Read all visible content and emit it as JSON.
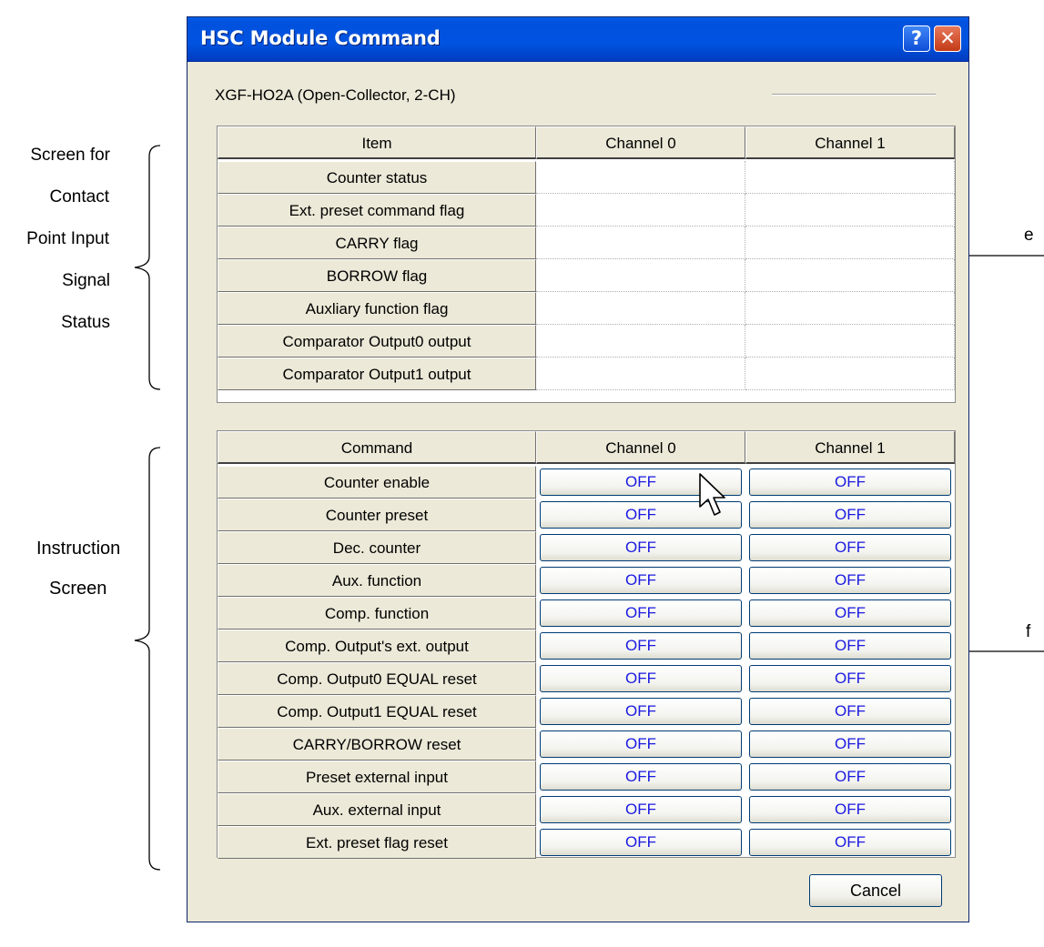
{
  "annotations": {
    "status_lines": [
      "Screen for",
      "Contact",
      "Point Input",
      "Signal",
      "Status"
    ],
    "instruction_lines": [
      "Instruction",
      "Screen"
    ],
    "marker_e": "e",
    "marker_f": "f"
  },
  "window": {
    "title": "HSC Module Command",
    "help_label": "?",
    "close_label": "✕"
  },
  "module": {
    "name": "XGF-HO2A (Open-Collector, 2-CH)"
  },
  "status_table": {
    "headers": [
      "Item",
      "Channel 0",
      "Channel 1"
    ],
    "rows": [
      "Counter status",
      "Ext. preset command flag",
      "CARRY flag",
      "BORROW flag",
      "Auxliary function flag",
      "Comparator Output0 output",
      "Comparator Output1 output"
    ]
  },
  "command_table": {
    "headers": [
      "Command",
      "Channel 0",
      "Channel 1"
    ],
    "rows": [
      {
        "label": "Counter enable",
        "ch0": "OFF",
        "ch1": "OFF"
      },
      {
        "label": "Counter preset",
        "ch0": "OFF",
        "ch1": "OFF"
      },
      {
        "label": "Dec. counter",
        "ch0": "OFF",
        "ch1": "OFF"
      },
      {
        "label": "Aux. function",
        "ch0": "OFF",
        "ch1": "OFF"
      },
      {
        "label": "Comp. function",
        "ch0": "OFF",
        "ch1": "OFF"
      },
      {
        "label": "Comp. Output's ext. output",
        "ch0": "OFF",
        "ch1": "OFF"
      },
      {
        "label": "Comp. Output0 EQUAL reset",
        "ch0": "OFF",
        "ch1": "OFF"
      },
      {
        "label": "Comp. Output1 EQUAL reset",
        "ch0": "OFF",
        "ch1": "OFF"
      },
      {
        "label": "CARRY/BORROW reset",
        "ch0": "OFF",
        "ch1": "OFF"
      },
      {
        "label": "Preset external input",
        "ch0": "OFF",
        "ch1": "OFF"
      },
      {
        "label": "Aux. external input",
        "ch0": "OFF",
        "ch1": "OFF"
      },
      {
        "label": "Ext. preset flag reset",
        "ch0": "OFF",
        "ch1": "OFF"
      }
    ]
  },
  "footer": {
    "cancel_label": "Cancel"
  },
  "colors": {
    "title_bar": "#0053e0",
    "dialog_bg": "#ece9d8",
    "off_text": "#1a1ae0"
  }
}
